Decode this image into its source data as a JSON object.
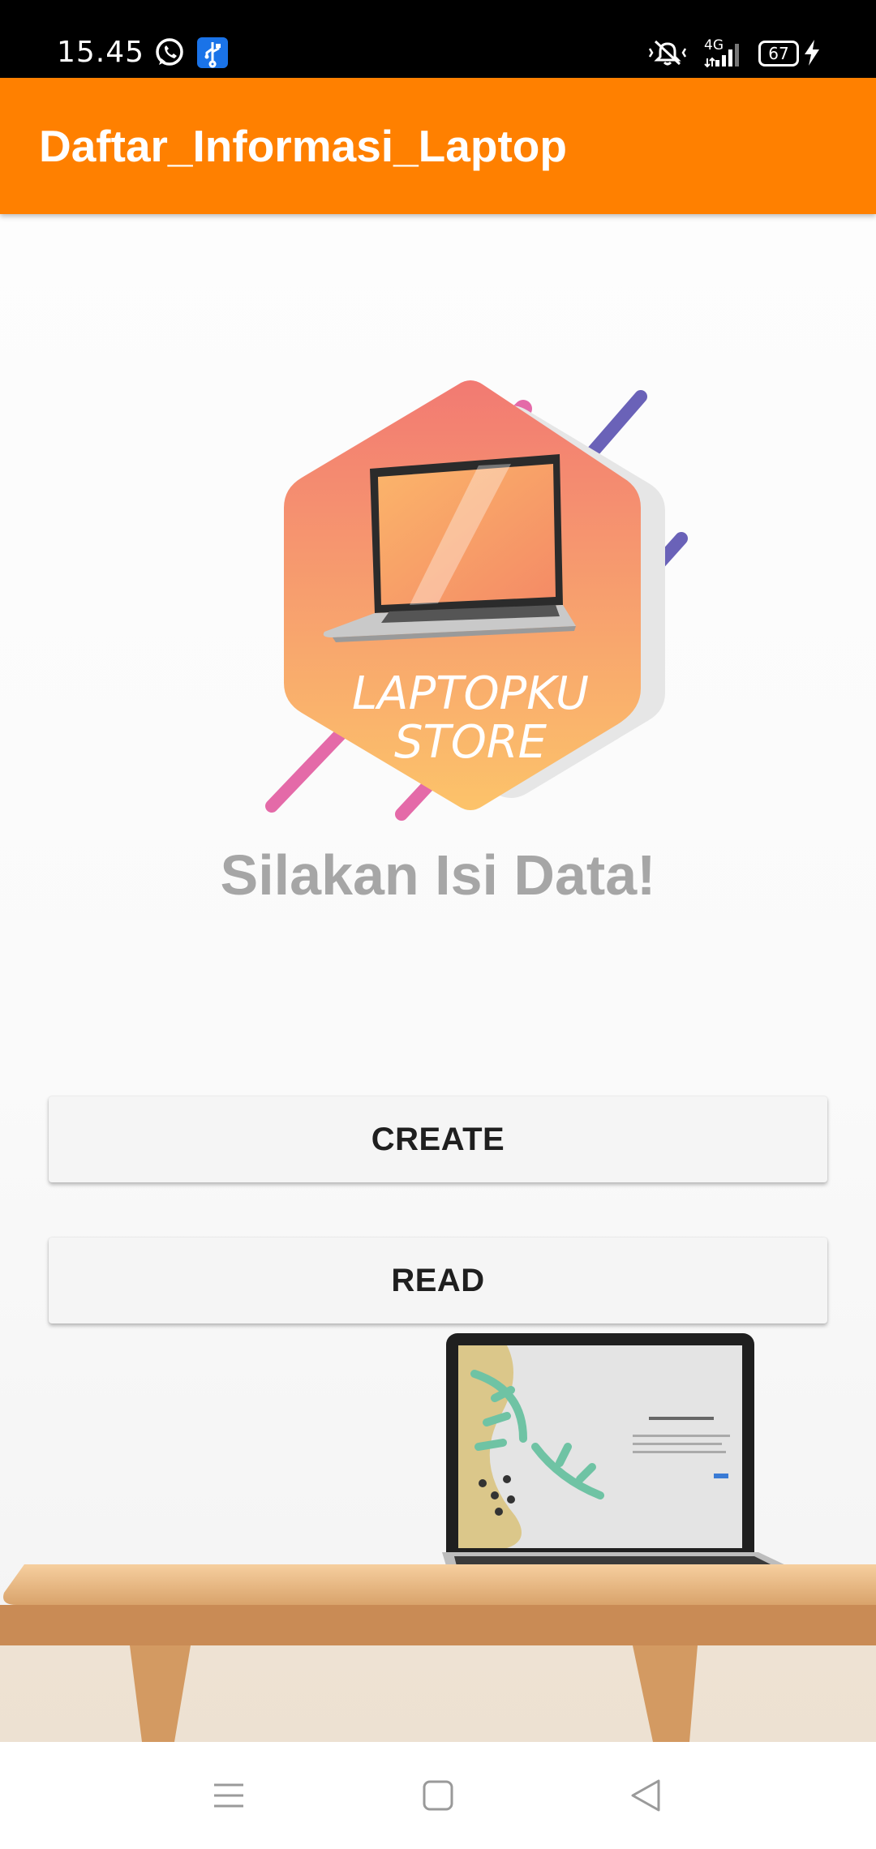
{
  "status_bar": {
    "time": "15.45",
    "battery": "67",
    "network": "4G",
    "icons": [
      "whatsapp-icon",
      "usb-icon",
      "vibrate-icon",
      "signal-icon",
      "battery-icon",
      "charging-icon"
    ]
  },
  "app_bar": {
    "title": "Daftar_Informasi_Laptop",
    "color": "#ff8000"
  },
  "logo": {
    "line1": "LAPTOPKU",
    "line2": "STORE"
  },
  "main": {
    "heading": "Silakan Isi Data!",
    "buttons": {
      "create": "CREATE",
      "read": "READ"
    }
  },
  "nav_bar": {
    "icons": [
      "menu-icon",
      "home-icon",
      "back-icon"
    ]
  }
}
